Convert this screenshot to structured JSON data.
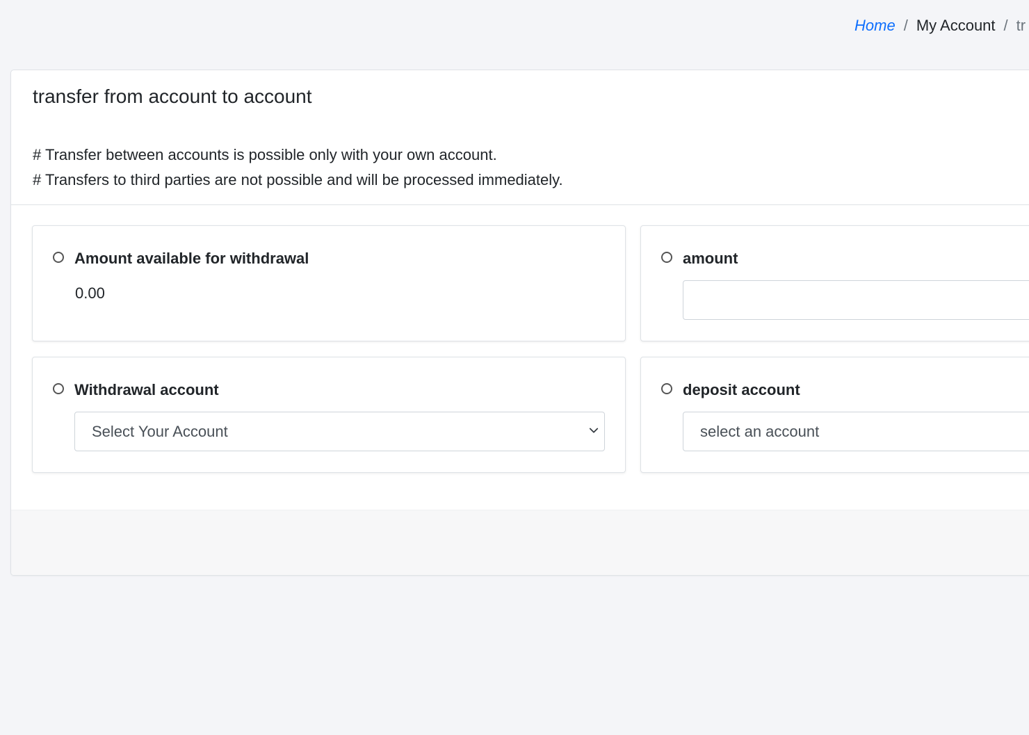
{
  "breadcrumb": {
    "home": "Home",
    "my_account": "My Account",
    "current": "tr",
    "separator": "/"
  },
  "card": {
    "title": "transfer from account to account",
    "notes": [
      "# Transfer between accounts is possible only with your own account.",
      "# Transfers to third parties are not possible and will be processed immediately."
    ]
  },
  "panels": {
    "available": {
      "label": "Amount available for withdrawal",
      "value": "0.00"
    },
    "amount": {
      "label": "amount",
      "value": ""
    },
    "withdrawal": {
      "label": "Withdrawal account",
      "selected": "Select Your Account"
    },
    "deposit": {
      "label": "deposit account",
      "selected": "select an account"
    }
  },
  "colors": {
    "link": "#0d6efd",
    "background": "#f4f5f8",
    "card": "#ffffff",
    "footer": "#f7f7f8"
  }
}
